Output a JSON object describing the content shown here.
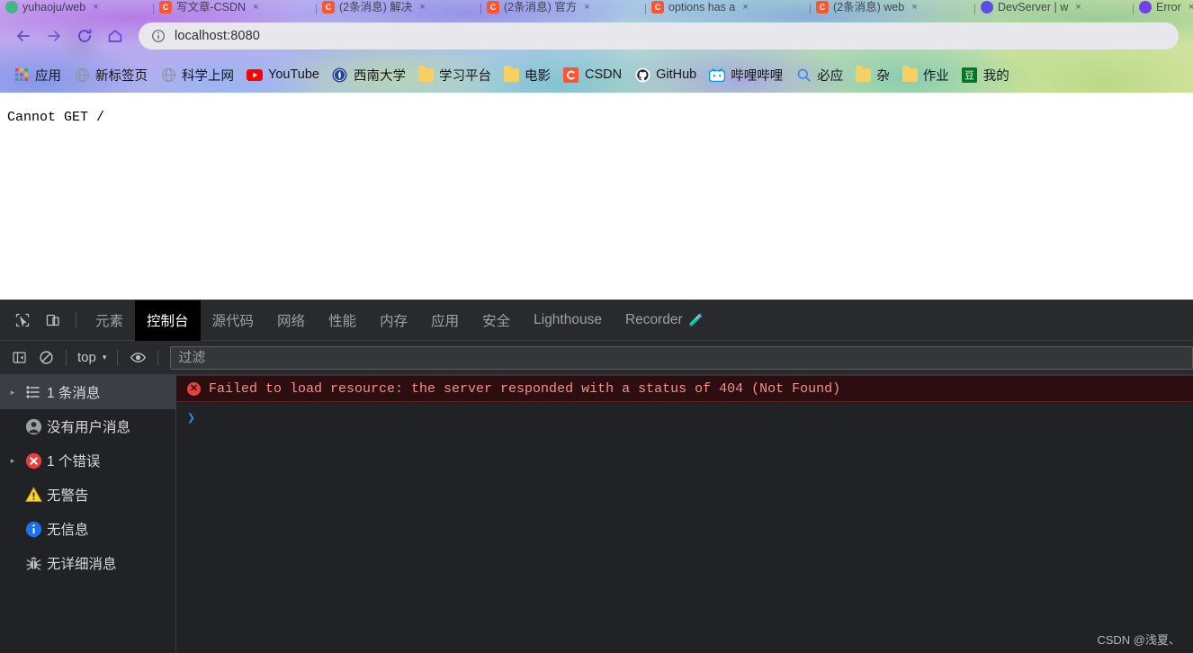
{
  "browser": {
    "tabs": [
      {
        "title": "yuhaoju/web",
        "favicon": "vue-icon",
        "close": "×"
      },
      {
        "title": "写文章-CSDN",
        "favicon": "csdn-icon",
        "close": "×"
      },
      {
        "title": "(2条消息) 解决",
        "favicon": "csdn-icon",
        "close": "×"
      },
      {
        "title": "(2条消息) 官方",
        "favicon": "csdn-icon",
        "close": "×"
      },
      {
        "title": "options has a",
        "favicon": "csdn-icon",
        "close": "×"
      },
      {
        "title": "(2条消息) web",
        "favicon": "csdn-icon",
        "close": "×"
      },
      {
        "title": "DevServer | w",
        "favicon": "git-icon",
        "close": "×"
      },
      {
        "title": "Error",
        "favicon": "error-icon",
        "close": "×"
      }
    ],
    "nav": {
      "back": "back-arrow",
      "forward": "forward-arrow",
      "reload": "reload-icon",
      "home": "home-icon"
    },
    "omnibox": {
      "info_icon": "info-circle-icon",
      "url": "localhost:8080"
    },
    "bookmarks": [
      {
        "label": "应用",
        "icon": "apps-grid-icon"
      },
      {
        "label": "新标签页",
        "icon": "globe-icon"
      },
      {
        "label": "科学上网",
        "icon": "globe-icon"
      },
      {
        "label": "YouTube",
        "icon": "youtube-icon"
      },
      {
        "label": "西南大学",
        "icon": "university-icon"
      },
      {
        "label": "学习平台",
        "icon": "folder-icon"
      },
      {
        "label": "电影",
        "icon": "folder-icon"
      },
      {
        "label": "CSDN",
        "icon": "csdn-icon"
      },
      {
        "label": "GitHub",
        "icon": "github-icon"
      },
      {
        "label": "哔哩哔哩",
        "icon": "bilibili-icon"
      },
      {
        "label": "必应",
        "icon": "search-icon"
      },
      {
        "label": "杂",
        "icon": "folder-icon"
      },
      {
        "label": "作业",
        "icon": "folder-icon"
      },
      {
        "label": "我的",
        "icon": "douban-icon"
      }
    ]
  },
  "page": {
    "body_text": "Cannot GET /"
  },
  "devtools": {
    "inspect_icon": "inspect-element-icon",
    "device_icon": "device-toolbar-icon",
    "tabs": [
      {
        "label": "元素",
        "active": false
      },
      {
        "label": "控制台",
        "active": true
      },
      {
        "label": "源代码",
        "active": false
      },
      {
        "label": "网络",
        "active": false
      },
      {
        "label": "性能",
        "active": false
      },
      {
        "label": "内存",
        "active": false
      },
      {
        "label": "应用",
        "active": false
      },
      {
        "label": "安全",
        "active": false
      },
      {
        "label": "Lighthouse",
        "active": false
      },
      {
        "label": "Recorder",
        "active": false,
        "badge": "🧪"
      }
    ],
    "filterbar": {
      "sidebar_toggle_icon": "console-sidebar-toggle-icon",
      "clear_icon": "clear-console-icon",
      "context": "top",
      "context_caret": "▾",
      "eye_icon": "live-expression-icon",
      "filter_placeholder": "过滤",
      "filter_value": ""
    },
    "sidebar": [
      {
        "label": "1 条消息",
        "icon": "list-icon",
        "arrow": "▸",
        "selected": true
      },
      {
        "label": "没有用户消息",
        "icon": "person-icon",
        "arrow": "",
        "selected": false
      },
      {
        "label": "1 个错误",
        "icon": "error-icon",
        "arrow": "▸",
        "selected": false
      },
      {
        "label": "无警告",
        "icon": "warning-icon",
        "arrow": "",
        "selected": false
      },
      {
        "label": "无信息",
        "icon": "info-icon",
        "arrow": "",
        "selected": false
      },
      {
        "label": "无详细消息",
        "icon": "bug-icon",
        "arrow": "",
        "selected": false
      }
    ],
    "console": {
      "error_icon": "error-badge-icon",
      "error_badge": "✕",
      "error_message": "Failed to load resource: the server responded with a status of 404 (Not Found)",
      "prompt_caret": "❯"
    },
    "watermark": "CSDN @浅夏、"
  },
  "colors": {
    "accent_blue": "#3b82f6",
    "error_red": "#e8423f",
    "error_text": "#f58f8c",
    "devtools_bg": "#212226",
    "devtools_header": "#292a2d"
  }
}
